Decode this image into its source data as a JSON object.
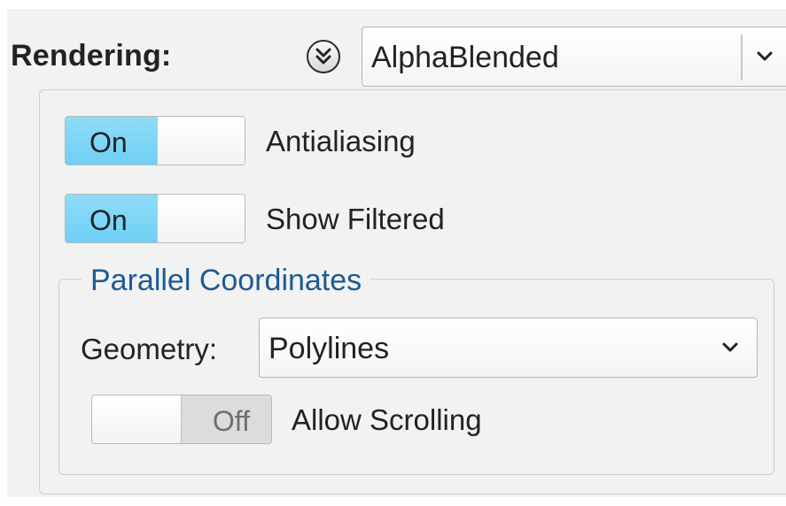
{
  "rendering": {
    "label": "Rendering:",
    "mode_value": "AlphaBlended",
    "collapse_icon": "double-chevron-down-icon"
  },
  "toggles": {
    "antialiasing": {
      "state_text": "On",
      "label": "Antialiasing",
      "on": true
    },
    "show_filtered": {
      "state_text": "On",
      "label": "Show Filtered",
      "on": true
    },
    "allow_scrolling": {
      "state_text": "Off",
      "label": "Allow Scrolling",
      "on": false
    }
  },
  "parallel_coordinates": {
    "title": "Parallel Coordinates",
    "geometry_label": "Geometry:",
    "geometry_value": "Polylines"
  },
  "colors": {
    "toggle_on": "#7dd6f6",
    "group_title": "#1e5a93",
    "panel_background": "#f2f2f2"
  }
}
